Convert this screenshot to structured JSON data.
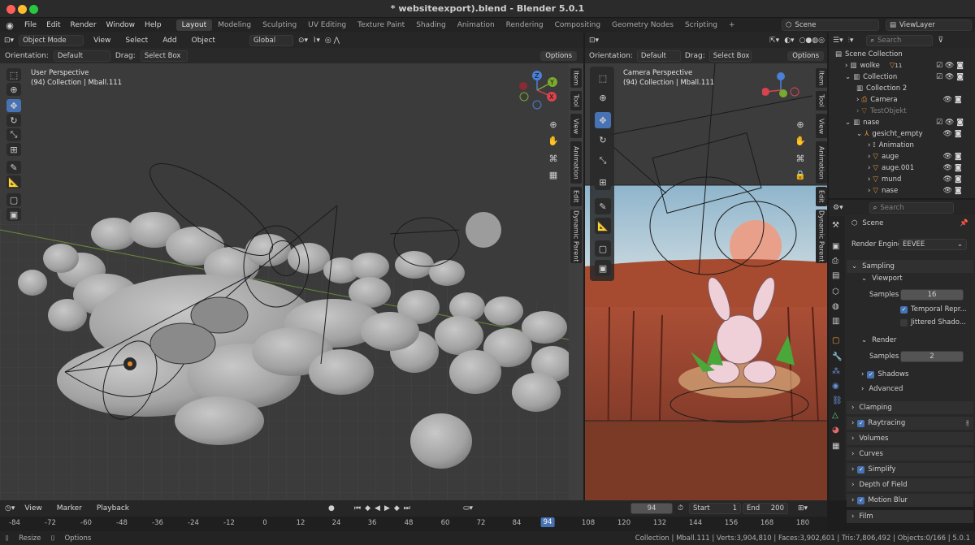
{
  "window_title": "* websiteexport).blend - Blender 5.0.1",
  "menu": [
    "File",
    "Edit",
    "Render",
    "Window",
    "Help"
  ],
  "workspaces": [
    "Layout",
    "Modeling",
    "Sculpting",
    "UV Editing",
    "Texture Paint",
    "Shading",
    "Animation",
    "Rendering",
    "Compositing",
    "Geometry Nodes",
    "Scripting"
  ],
  "active_workspace": "Layout",
  "add_workspace": "+",
  "scene_name": "Scene",
  "view_layer": "ViewLayer",
  "viewport_left": {
    "mode": "Object Mode",
    "menus": [
      "View",
      "Select",
      "Add",
      "Object"
    ],
    "transform_orientation": "Global",
    "orientation_label": "Orientation:",
    "orientation_value": "Default",
    "drag_label": "Drag:",
    "drag_value": "Select Box",
    "options": "Options",
    "overlay_line1": "User Perspective",
    "overlay_line2": "(94) Collection | Mball.111",
    "side_tabs": [
      "Item",
      "Tool",
      "View",
      "Animation",
      "Edit",
      "Dynamic Parent"
    ]
  },
  "viewport_right": {
    "orientation_label": "Orientation:",
    "orientation_value": "Default",
    "drag_label": "Drag:",
    "drag_value": "Select Box",
    "options": "Options",
    "overlay_line1": "Camera Perspective",
    "overlay_line2": "(94) Collection | Mball.111",
    "side_tabs": [
      "Item",
      "Tool",
      "View",
      "Animation",
      "Edit",
      "Dynamic Parent"
    ]
  },
  "outliner": {
    "search_placeholder": "Search",
    "items": [
      {
        "label": "Scene Collection"
      },
      {
        "label": "wolke",
        "count": "11"
      },
      {
        "label": "Collection"
      },
      {
        "label": "Collection 2"
      },
      {
        "label": "Camera"
      },
      {
        "label": "TestObjekt"
      },
      {
        "label": "nase"
      },
      {
        "label": "gesicht_empty"
      },
      {
        "label": "Animation"
      },
      {
        "label": "auge"
      },
      {
        "label": "auge.001"
      },
      {
        "label": "mund"
      },
      {
        "label": "nase"
      }
    ]
  },
  "properties": {
    "search_placeholder": "Search",
    "context": "Scene",
    "render_engine_label": "Render Engine",
    "render_engine": "EEVEE",
    "sampling": "Sampling",
    "viewport": "Viewport",
    "samples_label": "Samples",
    "viewport_samples": "16",
    "temporal": "Temporal Repr...",
    "jittered": "Jittered Shado...",
    "render": "Render",
    "render_samples_label": "Samples",
    "render_samples": "2",
    "shadows": "Shadows",
    "advanced": "Advanced",
    "panels": [
      "Clamping",
      "Raytracing",
      "Volumes",
      "Curves",
      "Simplify",
      "Depth of Field",
      "Motion Blur",
      "Film"
    ]
  },
  "timeline": {
    "menus": [
      "View",
      "Marker",
      "Playback"
    ],
    "current_frame": "94",
    "start_label": "Start",
    "start": "1",
    "end_label": "End",
    "end": "200",
    "ticks": [
      "-84",
      "-72",
      "-60",
      "-48",
      "-36",
      "-24",
      "-12",
      "0",
      "12",
      "24",
      "36",
      "48",
      "60",
      "72",
      "84",
      "94",
      "108",
      "120",
      "132",
      "144",
      "156",
      "168",
      "180"
    ]
  },
  "status": {
    "left": [
      "Resize",
      "Options"
    ],
    "right": "Collection | Mball.111 | Verts:3,904,810 | Faces:3,902,601 | Tris:7,806,492 | Objects:0/166 | 5.0.1"
  },
  "colors": {
    "accent": "#4772b3",
    "frame_marker": "#4772b3",
    "title_bg": "#2b2b2b"
  }
}
